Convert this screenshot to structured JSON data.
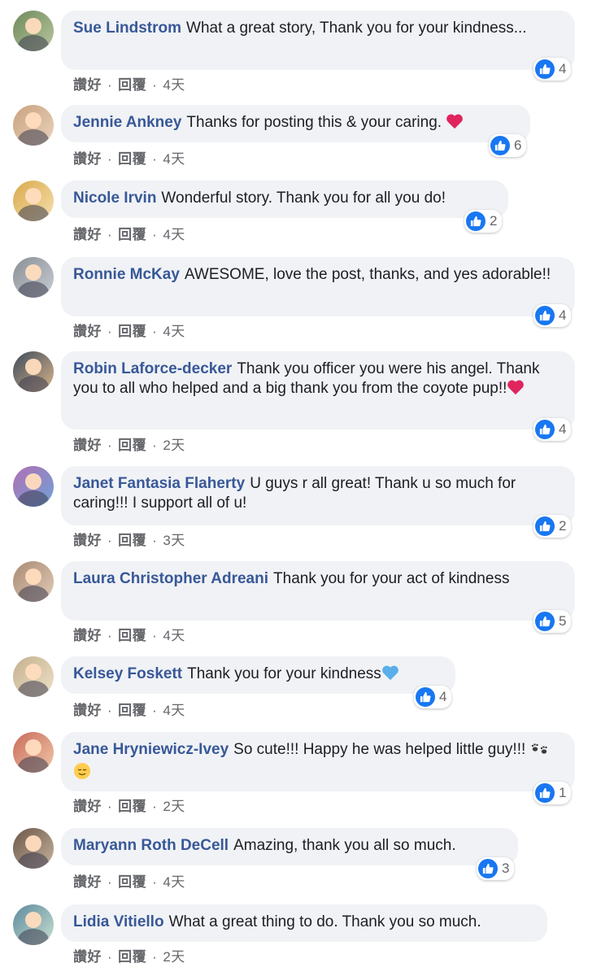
{
  "actions": {
    "like": "讚好",
    "reply": "回覆",
    "dot": "·"
  },
  "colors": {
    "author": "#385898",
    "bubble": "#f0f2f5",
    "like_blue": "#1877f2",
    "heart_red": "#e0245e",
    "heart_blue": "#5aaeea"
  },
  "comments": [
    {
      "author": "Sue Lindstrom",
      "text": "What a great story, Thank you for your kindness...",
      "likes": "4",
      "time": "4天"
    },
    {
      "author": "Jennie Ankney",
      "text": "Thanks for posting this & your caring. ",
      "emoji": "red-heart",
      "likes": "6",
      "time": "4天"
    },
    {
      "author": "Nicole Irvin",
      "text": "Wonderful story. Thank you for all you do!",
      "likes": "2",
      "time": "4天"
    },
    {
      "author": "Ronnie McKay",
      "text": "AWESOME, love the post, thanks, and yes adorable!!",
      "likes": "4",
      "time": "4天"
    },
    {
      "author": "Robin Laforce-decker",
      "text": "Thank you officer you were his angel. Thank you to all who helped and a big thank you from the coyote pup!!",
      "emoji": "red-heart",
      "likes": "4",
      "time": "2天"
    },
    {
      "author": "Janet Fantasia Flaherty",
      "text": "U guys r all great! Thank u so much for caring!!! I support all of u!",
      "likes": "2",
      "time": "3天"
    },
    {
      "author": "Laura Christopher Adreani",
      "text": "Thank you for your act of kindness",
      "likes": "5",
      "time": "4天"
    },
    {
      "author": "Kelsey Foskett",
      "text": "Thank you for your kindness",
      "emoji": "blue-heart",
      "likes": "4",
      "time": "4天"
    },
    {
      "author": "Jane Hryniewicz-Ivey",
      "text": "So cute!!! Happy he was helped little guy!!! ",
      "emoji": "paw-prints-relieved-face",
      "likes": "1",
      "time": "2天"
    },
    {
      "author": "Maryann Roth DeCell",
      "text": "Amazing, thank you all so much.",
      "likes": "3",
      "time": "4天"
    },
    {
      "author": "Lidia Vitiello",
      "text": "What a great thing to do. Thank you so much.",
      "time": "2天"
    }
  ]
}
